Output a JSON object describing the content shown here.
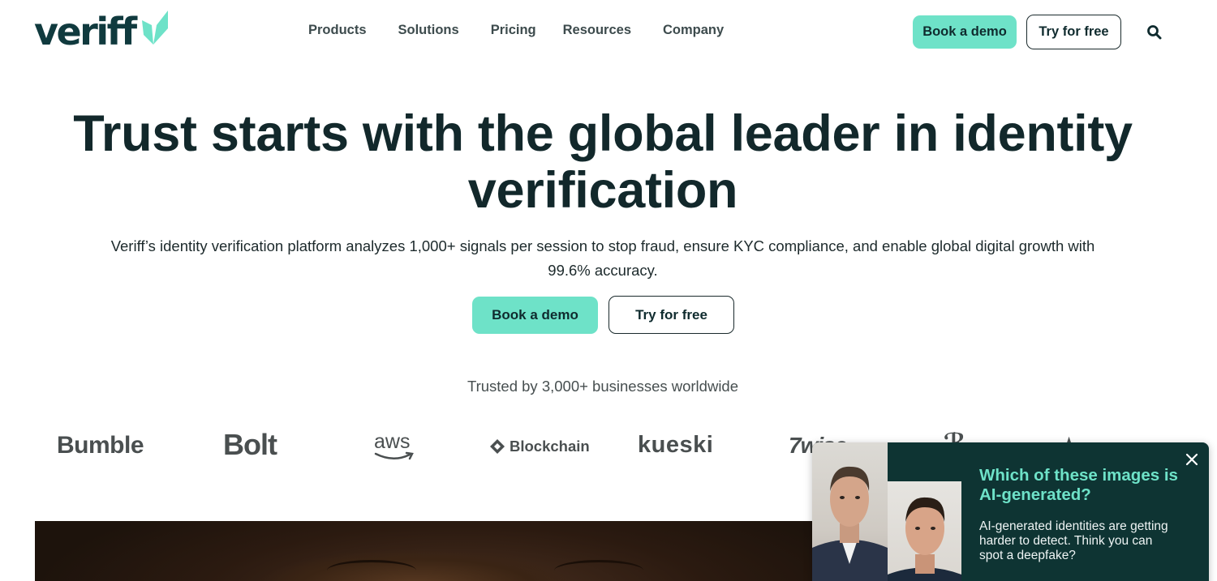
{
  "brand": {
    "logo_text": "veriff",
    "accent": "#6ee2c8",
    "dark": "#103a3e"
  },
  "nav": {
    "items": [
      {
        "label": "Products"
      },
      {
        "label": "Solutions"
      },
      {
        "label": "Pricing"
      },
      {
        "label": "Resources"
      },
      {
        "label": "Company"
      }
    ],
    "book_demo_label": "Book a demo",
    "try_free_label": "Try for free",
    "search_icon": "search-icon"
  },
  "hero": {
    "title": "Trust starts with the global leader in identity verification",
    "subtitle": "Veriff’s identity verification platform analyzes 1,000+ signals per session to stop fraud, ensure KYC compliance, and enable global digital growth with 99.6% accuracy.",
    "book_demo_label": "Book a demo",
    "try_free_label": "Try for free"
  },
  "trusted": {
    "text": "Trusted by 3,000+ businesses worldwide",
    "logos": [
      "Bumble",
      "Bolt",
      "aws",
      "Blockchain",
      "kueski",
      "wise"
    ]
  },
  "popup": {
    "title": "Which of these images is AI-generated?",
    "body": "AI-generated identities are getting harder to detect. Think you can spot a deepfake?",
    "close_icon": "close-icon"
  }
}
